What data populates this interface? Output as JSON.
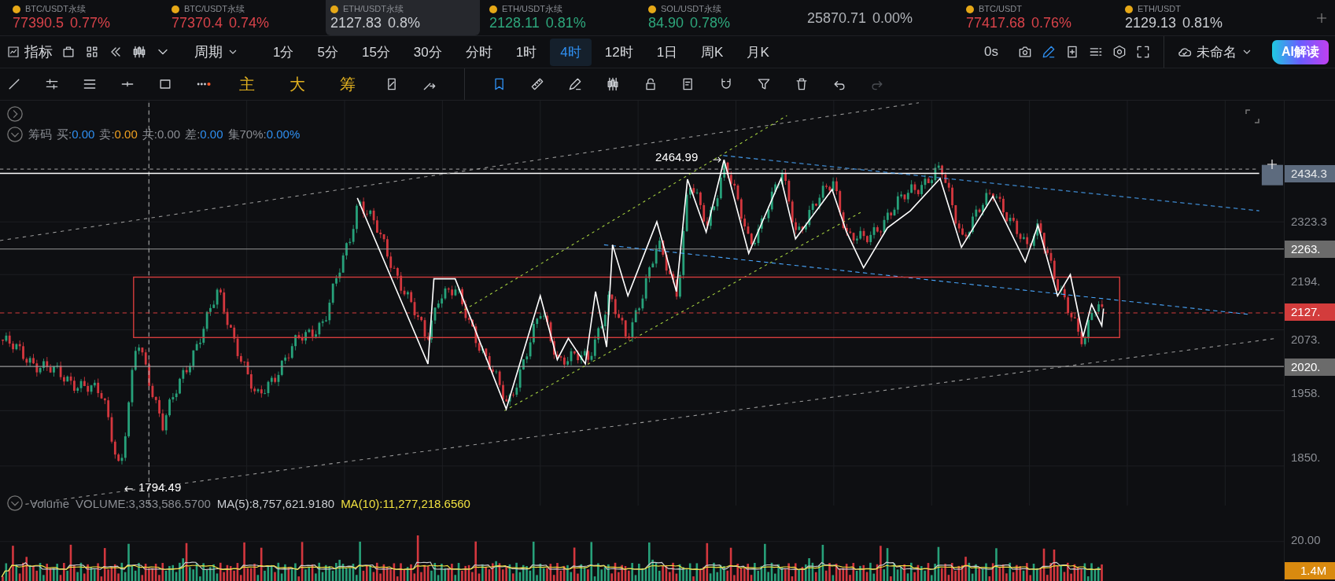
{
  "tickers": [
    {
      "name": "BTC/USDT永续",
      "price": "77390.5",
      "change": "0.77%",
      "color": "#d9434a",
      "selected": false
    },
    {
      "name": "BTC/USDT永续",
      "price": "77370.4",
      "change": "0.74%",
      "color": "#d9434a",
      "selected": false
    },
    {
      "name": "ETH/USDT永续",
      "price": "2127.83",
      "change": "0.8%",
      "color": "#c9ccd1",
      "selected": true
    },
    {
      "name": "ETH/USDT永续",
      "price": "2128.11",
      "change": "0.81%",
      "color": "#2ea77c",
      "selected": false
    },
    {
      "name": "SOL/USDT永续",
      "price": "84.90",
      "change": "0.78%",
      "color": "#2ea77c",
      "selected": false
    },
    {
      "price": "25870.71",
      "change": "0.00%",
      "color": "#b0b3b8",
      "selected": false
    },
    {
      "name": "BTC/USDT",
      "price": "77417.68",
      "change": "0.76%",
      "color": "#d9434a",
      "selected": false
    },
    {
      "name": "ETH/USDT",
      "price": "2129.13",
      "change": "0.81%",
      "color": "#c9ccd1",
      "selected": false
    }
  ],
  "toolbar": {
    "indicator_label": "指标",
    "period_label": "周期",
    "intervals": [
      {
        "label": "1分",
        "selected": false
      },
      {
        "label": "5分",
        "selected": false
      },
      {
        "label": "15分",
        "selected": false
      },
      {
        "label": "30分",
        "selected": false
      },
      {
        "label": "分时",
        "selected": false
      },
      {
        "label": "1时",
        "selected": false
      },
      {
        "label": "4时",
        "selected": true
      },
      {
        "label": "12时",
        "selected": false
      },
      {
        "label": "1日",
        "selected": false
      },
      {
        "label": "周K",
        "selected": false
      },
      {
        "label": "月K",
        "selected": false
      }
    ],
    "countdown": "0s",
    "icons": [
      {
        "selected": false
      },
      {
        "selected": true
      },
      {
        "selected": false
      },
      {
        "selected": false
      },
      {
        "selected": false
      },
      {
        "selected": false
      }
    ],
    "layout_name": "未命名",
    "ai_button": "AI解读"
  },
  "drawing_tools": {
    "left": [
      {
        "selected": false
      },
      {
        "selected": false
      },
      {
        "selected": false
      },
      {
        "selected": false
      },
      {
        "selected": false
      },
      {
        "selected": false
      }
    ],
    "text_buttons": [
      "主",
      "大",
      "筹"
    ],
    "right": [
      {
        "selected": false,
        "disabled": false
      },
      {
        "selected": false,
        "disabled": false
      },
      {
        "selected": true,
        "disabled": false
      },
      {
        "selected": false,
        "disabled": false
      },
      {
        "selected": false,
        "disabled": false
      },
      {
        "selected": false,
        "disabled": false
      },
      {
        "selected": false,
        "disabled": false
      },
      {
        "selected": false,
        "disabled": false
      },
      {
        "selected": false,
        "disabled": false
      },
      {
        "selected": false,
        "disabled": false
      },
      {
        "selected": false,
        "disabled": false
      },
      {
        "selected": false,
        "disabled": false
      },
      {
        "selected": false,
        "disabled": true
      }
    ]
  },
  "indicator": {
    "name": "筹码",
    "items": [
      {
        "label": "买:",
        "value": "0.00",
        "color": "#2f8ff0"
      },
      {
        "label": "卖:",
        "value": "0.00",
        "color": "#f0a020"
      },
      {
        "label": "共:",
        "value": "0.00",
        "color": "#8a8d93"
      },
      {
        "label": "差:",
        "value": "0.00",
        "color": "#2f8ff0"
      },
      {
        "label": "集70%:",
        "value": "0.00%",
        "color": "#2f8ff0"
      }
    ]
  },
  "annotations": {
    "high": "2464.99",
    "low": "1794.49"
  },
  "price_axis": [
    {
      "text": "2434.3",
      "kind": "marker"
    },
    {
      "text": "2323.3",
      "kind": "tick"
    },
    {
      "text": "2263.",
      "kind": "line"
    },
    {
      "text": "2194.",
      "kind": "tick"
    },
    {
      "text": "2127.",
      "kind": "current"
    },
    {
      "text": "2073.",
      "kind": "tick"
    },
    {
      "text": "2020.",
      "kind": "line"
    },
    {
      "text": "1958.",
      "kind": "tick"
    },
    {
      "text": "1850.",
      "kind": "tick"
    },
    {
      "text": "20.00",
      "kind": "tick"
    },
    {
      "text": "1.4M",
      "kind": "volume"
    }
  ],
  "volume_legend": {
    "name": "Volume",
    "items": [
      {
        "text": "VOLUME:3,353,586.5700",
        "color": "#8a8d93"
      },
      {
        "text": "MA(5):8,757,621.9180",
        "color": "#c9ccd1"
      },
      {
        "text": "MA(10):11,277,218.6560",
        "color": "#f0e040"
      }
    ]
  }
}
